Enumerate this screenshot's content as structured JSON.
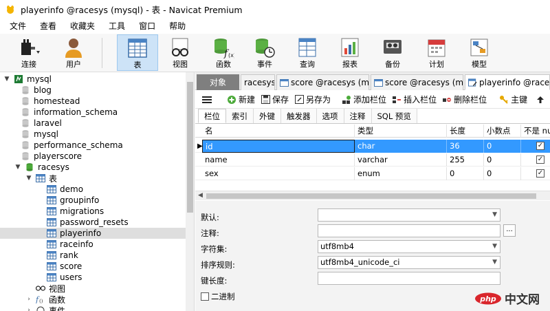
{
  "window": {
    "title": "playerinfo @racesys (mysql) - 表 - Navicat Premium"
  },
  "menu": [
    "文件",
    "查看",
    "收藏夹",
    "工具",
    "窗口",
    "帮助"
  ],
  "toolbar": {
    "connect": "连接",
    "user": "用户",
    "table": "表",
    "view": "视图",
    "function": "函数",
    "event": "事件",
    "query": "查询",
    "report": "报表",
    "backup": "备份",
    "schedule": "计划",
    "model": "模型"
  },
  "tree": {
    "connection": "mysql",
    "databases": [
      "blog",
      "homestead",
      "information_schema",
      "laravel",
      "mysql",
      "performance_schema",
      "playerscore"
    ],
    "open_db": "racesys",
    "tables_folder": "表",
    "tables": [
      "demo",
      "groupinfo",
      "migrations",
      "password_resets",
      "playerinfo",
      "raceinfo",
      "rank",
      "score",
      "users"
    ],
    "selected_table": "playerinfo",
    "views_folder": "视图",
    "functions_folder": "函数",
    "events_folder": "事件"
  },
  "tabs": {
    "objects": "对象",
    "tab1": "racesys",
    "tab2": "score @racesys (m...",
    "tab3": "score @racesys (m...",
    "current": "playerinfo @racesy..."
  },
  "design_toolbar": {
    "new": "新建",
    "save": "保存",
    "save_as": "另存为",
    "add_field": "添加栏位",
    "insert_field": "插入栏位",
    "delete_field": "删除栏位",
    "primary_key": "主键"
  },
  "subtabs": [
    "栏位",
    "索引",
    "外键",
    "触发器",
    "选项",
    "注释",
    "SQL 预览"
  ],
  "grid": {
    "headers": {
      "name": "名",
      "type": "类型",
      "length": "长度",
      "decimals": "小数点",
      "not_null": "不是 nu"
    },
    "rows": [
      {
        "name": "id",
        "type": "char",
        "length": "36",
        "decimals": "0",
        "not_null": true,
        "selected": true
      },
      {
        "name": "name",
        "type": "varchar",
        "length": "255",
        "decimals": "0",
        "not_null": true,
        "selected": false
      },
      {
        "name": "sex",
        "type": "enum",
        "length": "0",
        "decimals": "0",
        "not_null": true,
        "selected": false
      }
    ]
  },
  "props": {
    "default_label": "默认:",
    "default_value": "",
    "comment_label": "注释:",
    "comment_value": "",
    "charset_label": "字符集:",
    "charset_value": "utf8mb4",
    "collation_label": "排序规则:",
    "collation_value": "utf8mb4_unicode_ci",
    "keylen_label": "键长度:",
    "keylen_value": "",
    "binary_label": "二进制",
    "dots": "..."
  },
  "watermark": {
    "text": "中文网"
  },
  "colors": {
    "selection": "#3399ff",
    "tree_selected": "#dedede",
    "toolbar_active": "#cde3f7",
    "watermark_red": "#d9262c"
  }
}
